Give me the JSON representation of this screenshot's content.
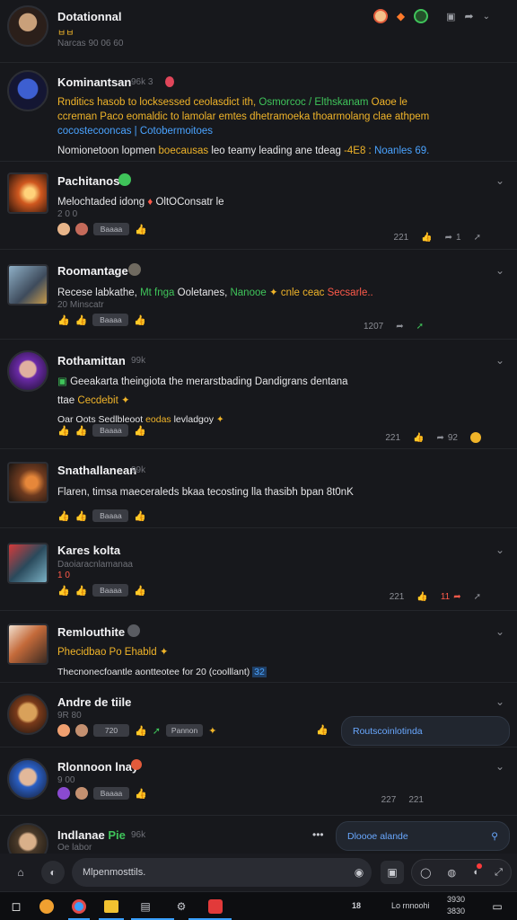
{
  "header": {
    "name": "Dotationnal",
    "sub": "ㅂㅂ",
    "meta": "Narcas 90 06 60",
    "icons": [
      "avatar-emoji-icon",
      "shield-icon",
      "leaf-icon",
      "play-icon",
      "share-icon",
      "chevron-down-icon"
    ]
  },
  "posts": [
    {
      "name": "Kominantsan",
      "tag": "96k 3",
      "line1_a": "Rnditics hasob to locksessed ceolasdict ith,",
      "line1_b": "Osmorcoc / Elthskanam",
      "line1_c": "Oaoe le",
      "line2": "ccreman Paco eomaldic to lamolar emtes dhetramoeka thoarmolang clae athpem",
      "line3": "cocostecooncas | Cotobermoitoes",
      "line4_a": "Nomionetoon lopmen",
      "line4_b": "boecausas",
      "line4_c": "leo teamy leading ane tdeag",
      "line4_d": "-4E8 :",
      "line4_e": "Noanles 69."
    },
    {
      "name": "Pachitanos",
      "line1": "Melochtaded idong",
      "line1_b": "OltOConsatr le",
      "meta": "2 0 0",
      "pill": "Baaaa",
      "stats": [
        "221",
        "",
        "1"
      ]
    },
    {
      "name": "Roomantage",
      "line1_a": "Recese labkathe,",
      "line1_b": "Mt fnga",
      "line1_c": "Ooletanes,",
      "line1_d": "Nanooe",
      "line1_e": "cnle ceac",
      "line1_f": "Secsarle..",
      "meta": "20 Minscatr",
      "pill": "Baaaa",
      "stats": [
        "1207"
      ]
    },
    {
      "name": "Rothamittan",
      "tag": "99k",
      "line1": "Geeakarta theingiota the merarstbading Dandigrans dentana",
      "line2_a": "ttae",
      "line2_b": "Cecdebit",
      "line3_a": "Oar Oots Sedlbleoot",
      "line3_b": "eodas",
      "line3_c": "levladgoy",
      "pill": "Baaaa",
      "stats": [
        "221",
        "",
        "92"
      ]
    },
    {
      "name": "Snathallanean",
      "tag": "99k",
      "line1": "Flaren, timsa maeceraleds bkaa tecosting lla thasibh bpan 8t0nK",
      "pill": "Baaaa"
    },
    {
      "name": "Kares kolta",
      "meta": "Daoiaracnlamanaa",
      "meta2": "1 0",
      "pill": "Baaaa",
      "stats": [
        "221",
        "",
        "11"
      ]
    },
    {
      "name": "Remlouthite",
      "line1": "Phecidbao Po Ehabld",
      "line2_a": "Thecnonecfoantle aontteotee for 20",
      "line2_b": "(coolllant)",
      "line2_c": "32"
    },
    {
      "name": "Andre de tiile",
      "meta": "9R 80",
      "pill1": "720",
      "pill2": "Pannon",
      "bubble": "Routscoinlotinda"
    },
    {
      "name": "Rlonnoon lnay",
      "meta": "9 00",
      "pill": "Baaaa",
      "stats": [
        "227",
        "221"
      ]
    },
    {
      "name": "Indlanae",
      "tag2": "Pie",
      "tag": "96k",
      "meta": "Oe labor",
      "bubble": "Dloooe alande"
    }
  ],
  "composer": {
    "placeholder": "Mlpenmosttils."
  },
  "taskbar": {
    "time_label": "18",
    "status": "Lo rnnoohi",
    "clock1": "3930",
    "clock2": "3830"
  },
  "colors": {
    "background": "#17181c",
    "accent_blue": "#4aa3ff",
    "accent_yellow": "#f0b429",
    "accent_green": "#3fc45a",
    "accent_red": "#ff5a4a"
  }
}
